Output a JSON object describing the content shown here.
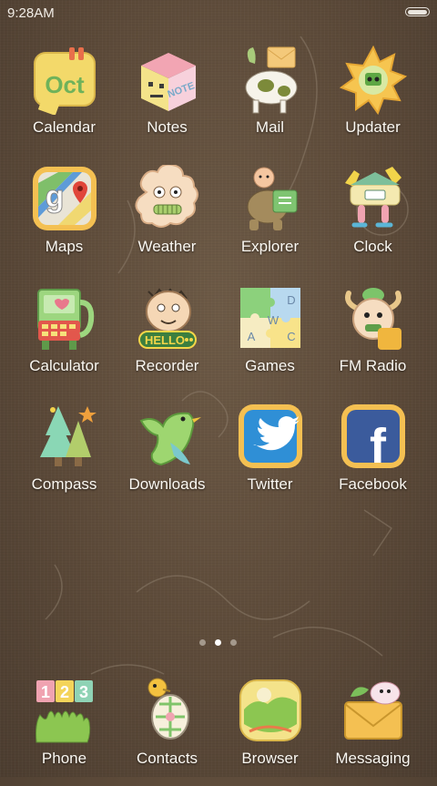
{
  "status_bar": {
    "time": "9:28AM",
    "battery_icon": "battery-icon"
  },
  "apps": [
    {
      "label": "Calendar",
      "icon": "calendar-icon"
    },
    {
      "label": "Notes",
      "icon": "notes-icon"
    },
    {
      "label": "Mail",
      "icon": "mail-icon"
    },
    {
      "label": "Updater",
      "icon": "updater-icon"
    },
    {
      "label": "Maps",
      "icon": "maps-icon"
    },
    {
      "label": "Weather",
      "icon": "weather-icon"
    },
    {
      "label": "Explorer",
      "icon": "explorer-icon"
    },
    {
      "label": "Clock",
      "icon": "clock-icon"
    },
    {
      "label": "Calculator",
      "icon": "calculator-icon"
    },
    {
      "label": "Recorder",
      "icon": "recorder-icon"
    },
    {
      "label": "Games",
      "icon": "games-icon"
    },
    {
      "label": "FM Radio",
      "icon": "fm-radio-icon"
    },
    {
      "label": "Compass",
      "icon": "compass-icon"
    },
    {
      "label": "Downloads",
      "icon": "downloads-icon"
    },
    {
      "label": "Twitter",
      "icon": "twitter-icon"
    },
    {
      "label": "Facebook",
      "icon": "facebook-icon"
    }
  ],
  "icon_text": {
    "calendar": "Oct",
    "notes": "NOTE",
    "maps": "g",
    "recorder": "HELLO",
    "games_letters": [
      "D",
      "A",
      "W",
      "C"
    ],
    "phone_digits": [
      "1",
      "2",
      "3"
    ],
    "facebook": "f"
  },
  "page_indicator": {
    "count": 3,
    "active_index": 1
  },
  "dock": [
    {
      "label": "Phone",
      "icon": "phone-icon"
    },
    {
      "label": "Contacts",
      "icon": "contacts-icon"
    },
    {
      "label": "Browser",
      "icon": "browser-icon"
    },
    {
      "label": "Messaging",
      "icon": "messaging-icon"
    }
  ]
}
